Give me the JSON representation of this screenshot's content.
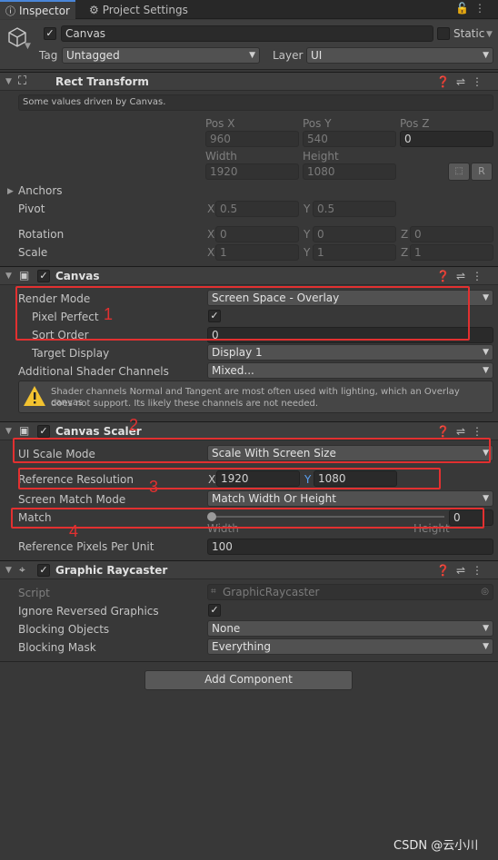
{
  "tabs": {
    "inspector": "Inspector",
    "project_settings": "Project Settings"
  },
  "header": {
    "object_name": "Canvas",
    "static_label": "Static",
    "tag_label": "Tag",
    "tag_value": "Untagged",
    "layer_label": "Layer",
    "layer_value": "UI"
  },
  "rect_transform": {
    "title": "Rect Transform",
    "note": "Some values driven by Canvas.",
    "pos_x_label": "Pos X",
    "pos_y_label": "Pos Y",
    "pos_z_label": "Pos Z",
    "pos_x": "960",
    "pos_y": "540",
    "pos_z": "0",
    "width_label": "Width",
    "height_label": "Height",
    "width": "1920",
    "height": "1080",
    "r_button": "R",
    "anchors_label": "Anchors",
    "pivot_label": "Pivot",
    "pivot_x": "0.5",
    "pivot_y": "0.5",
    "rotation_label": "Rotation",
    "rot_x": "0",
    "rot_y": "0",
    "rot_z": "0",
    "scale_label": "Scale",
    "scale_x": "1",
    "scale_y": "1",
    "scale_z": "1",
    "axis_x": "X",
    "axis_y": "Y",
    "axis_z": "Z"
  },
  "canvas": {
    "title": "Canvas",
    "render_mode_label": "Render Mode",
    "render_mode_value": "Screen Space - Overlay",
    "pixel_perfect_label": "Pixel Perfect",
    "sort_order_label": "Sort Order",
    "sort_order_value": "0",
    "target_display_label": "Target Display",
    "target_display_value": "Display 1",
    "shader_channels_label": "Additional Shader Channels",
    "shader_channels_value": "Mixed...",
    "warning_line1": "Shader channels Normal and Tangent are most often used with lighting, which an Overlay canvas",
    "warning_line2": "does not support. Its likely these channels are not needed."
  },
  "canvas_scaler": {
    "title": "Canvas Scaler",
    "ui_scale_mode_label": "UI Scale Mode",
    "ui_scale_mode_value": "Scale With Screen Size",
    "ref_res_label": "Reference Resolution",
    "ref_res_x": "1920",
    "ref_res_y": "1080",
    "screen_match_label": "Screen Match Mode",
    "screen_match_value": "Match Width Or Height",
    "match_label": "Match",
    "match_value": "0",
    "match_fraction": 0,
    "width_label": "Width",
    "height_label": "Height",
    "ref_ppu_label": "Reference Pixels Per Unit",
    "ref_ppu_value": "100"
  },
  "graphic_raycaster": {
    "title": "Graphic Raycaster",
    "script_label": "Script",
    "script_value": "GraphicRaycaster",
    "ignore_reversed_label": "Ignore Reversed Graphics",
    "blocking_objects_label": "Blocking Objects",
    "blocking_objects_value": "None",
    "blocking_mask_label": "Blocking Mask",
    "blocking_mask_value": "Everything"
  },
  "add_component_label": "Add Component",
  "annotations": {
    "n1": "1",
    "n2": "2",
    "n3": "3",
    "n4": "4"
  },
  "watermark": "CSDN @云小川",
  "colors": {
    "annotation_red": "#e23030",
    "background": "#383838",
    "accent_blue": "#4a86d8"
  }
}
